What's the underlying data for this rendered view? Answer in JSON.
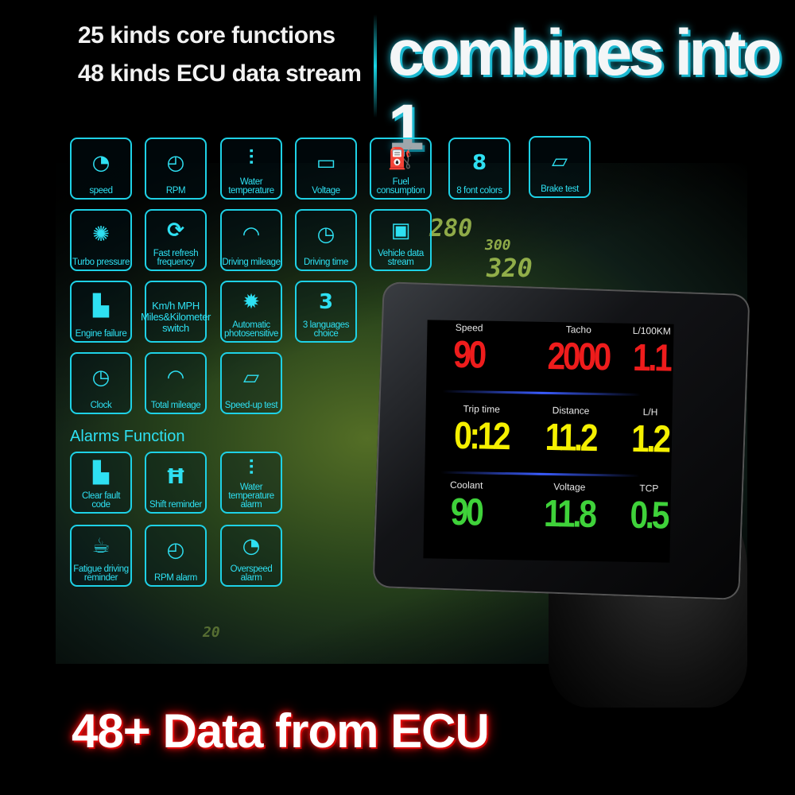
{
  "header": {
    "line1": "25 kinds core functions",
    "line2": "48 kinds ECU data stream",
    "slogan": "combines into 1"
  },
  "background_scale": [
    "280",
    "300",
    "320",
    "20"
  ],
  "features": [
    {
      "label": "speed",
      "icon": "speedometer-icon"
    },
    {
      "label": "RPM",
      "icon": "tachometer-icon"
    },
    {
      "label": "Water temperature",
      "icon": "thermometer-icon"
    },
    {
      "label": "Voltage",
      "icon": "battery-icon"
    },
    {
      "label": "Fuel consumption",
      "icon": "oil-can-icon"
    },
    {
      "label": "8 font colors",
      "icon": "digit-8-icon"
    },
    {
      "label": "Brake test",
      "icon": "car-icon"
    },
    {
      "label": "Turbo pressure",
      "icon": "turbo-icon"
    },
    {
      "label": "Fast refresh frequency",
      "icon": "refresh-icon"
    },
    {
      "label": "Driving mileage",
      "icon": "gauge-icon"
    },
    {
      "label": "Driving time",
      "icon": "clock-icon"
    },
    {
      "label": "Vehicle data stream",
      "icon": "chip-icon"
    },
    {
      "label": "Km/h MPH Miles&Kilometer switch",
      "icon": ""
    },
    {
      "label": "Engine failure",
      "icon": "engine-icon"
    },
    {
      "label": "Automatic photosensitive",
      "icon": "sensor-icon"
    },
    {
      "label": "3 languages choice",
      "icon": "digit-3-icon"
    },
    {
      "label": "Clock",
      "icon": "clock-icon"
    },
    {
      "label": "Total mileage",
      "icon": "gauge-icon"
    },
    {
      "label": "Speed-up test",
      "icon": "car-icon"
    }
  ],
  "alarms_title": "Alarms Function",
  "alarms": [
    {
      "label": "Clear fault code",
      "icon": "engine-icon"
    },
    {
      "label": "Shift reminder",
      "icon": "gear-shift-icon"
    },
    {
      "label": "Water temperature alarm",
      "icon": "thermometer-icon"
    },
    {
      "label": "Fatigue driving reminder",
      "icon": "coffee-cup-icon"
    },
    {
      "label": "RPM alarm",
      "icon": "tachometer-icon"
    },
    {
      "label": "Overspeed alarm",
      "icon": "speedometer-icon"
    }
  ],
  "display": {
    "readings": [
      {
        "title": "Speed",
        "value": "90",
        "color": "#ee1c1c"
      },
      {
        "title": "Tacho",
        "value": "2000",
        "color": "#ee1c1c"
      },
      {
        "title": "L/100KM",
        "value": "1.1",
        "color": "#ee1c1c"
      },
      {
        "title": "Trip time",
        "value": "0:12",
        "color": "#f5f000"
      },
      {
        "title": "Distance",
        "value": "11.2",
        "color": "#f5f000"
      },
      {
        "title": "L/H",
        "value": "1.2",
        "color": "#f5f000"
      },
      {
        "title": "Coolant",
        "value": "90",
        "color": "#3fd23a"
      },
      {
        "title": "Voltage",
        "value": "11.8",
        "color": "#3fd23a"
      },
      {
        "title": "TCP",
        "value": "0.5",
        "color": "#3fd23a"
      }
    ]
  },
  "footer": "48+ Data from ECU",
  "colors": {
    "accent": "#1ed1e6",
    "footer_glow": "#e00000"
  }
}
